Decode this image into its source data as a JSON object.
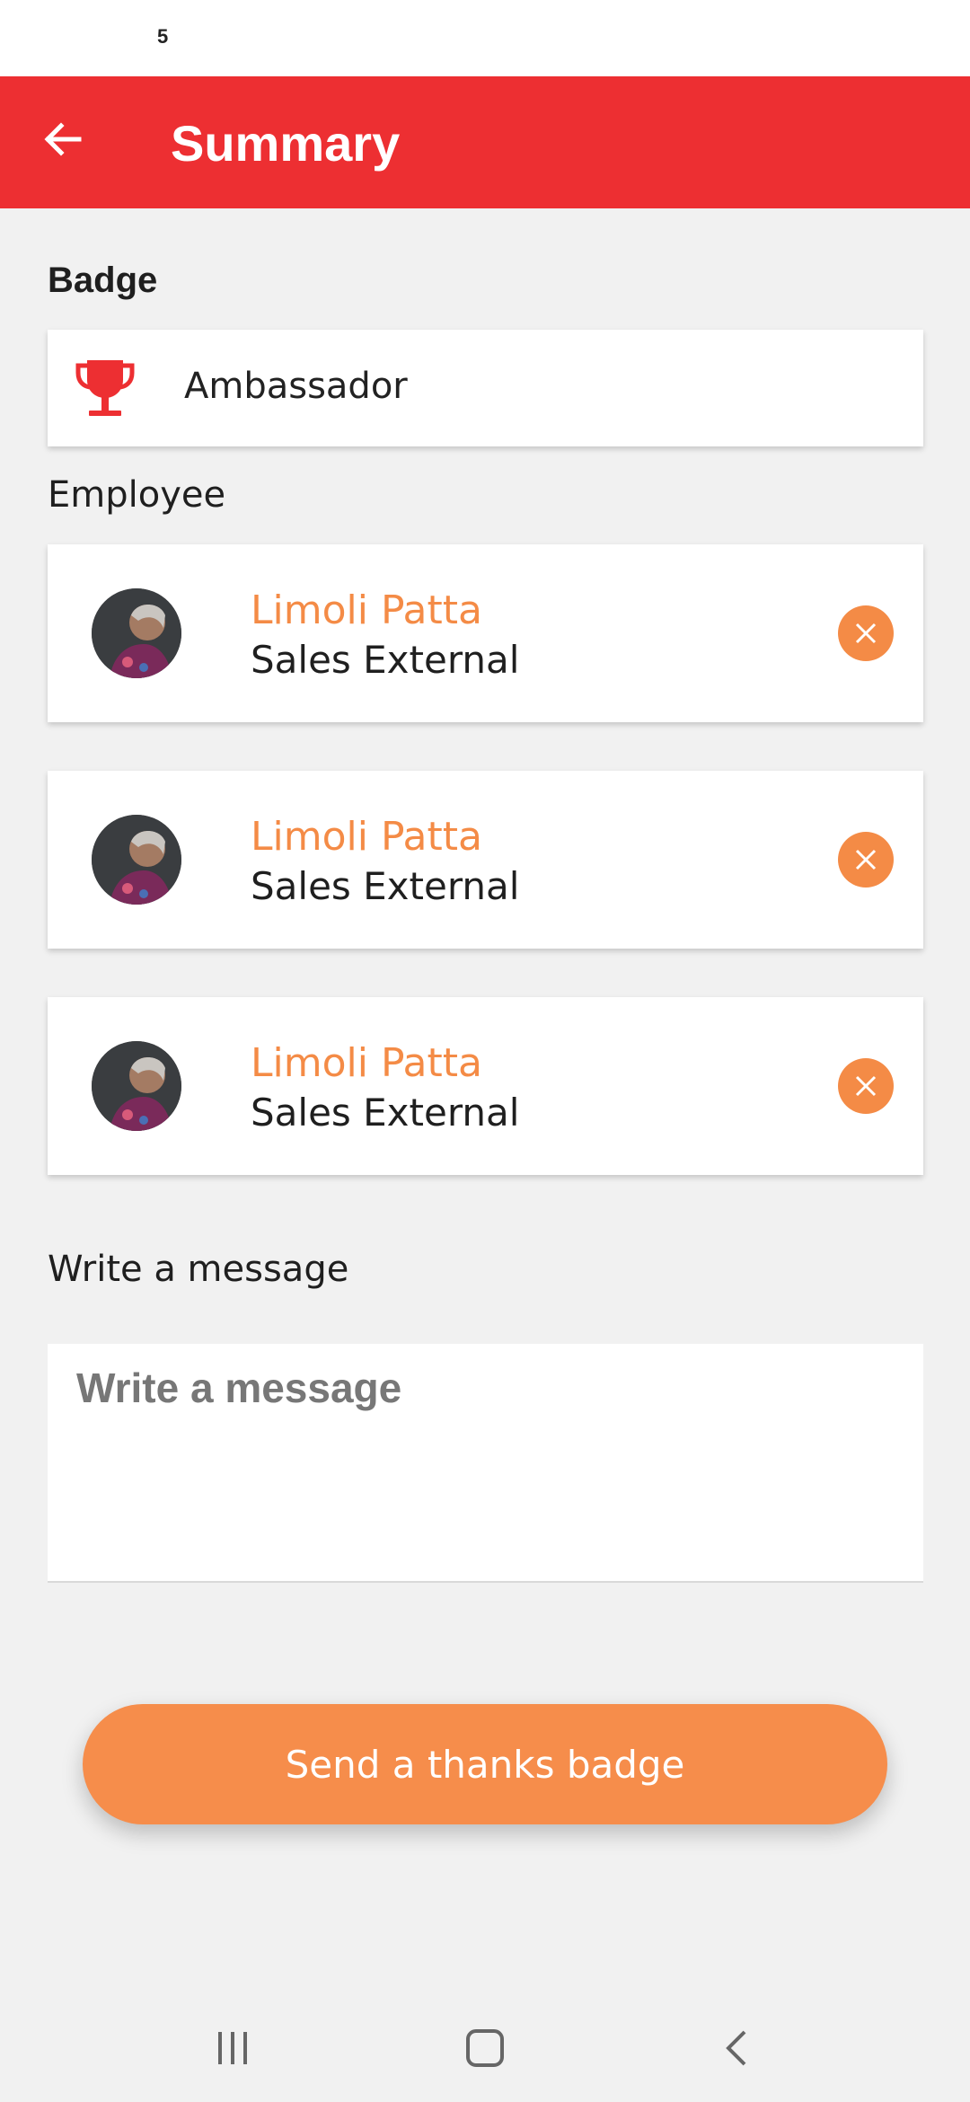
{
  "status_bar": {
    "time": "5"
  },
  "app_bar": {
    "title": "Summary",
    "back_icon": "arrow-left-icon"
  },
  "badge": {
    "section_label": "Badge",
    "icon": "trophy-icon",
    "name": "Ambassador"
  },
  "employee": {
    "section_label": "Employee",
    "items": [
      {
        "name": "Limoli Patta",
        "role": "Sales External"
      },
      {
        "name": "Limoli Patta",
        "role": "Sales External"
      },
      {
        "name": "Limoli Patta",
        "role": "Sales External"
      }
    ]
  },
  "message": {
    "section_label": "Write a message",
    "placeholder": "Write a message",
    "value": ""
  },
  "send_button": {
    "label": "Send a thanks badge"
  },
  "colors": {
    "app_bar": "#ed2f32",
    "accent_orange": "#f48b46",
    "button": "#f68d4b",
    "background": "#f1f1f1"
  }
}
